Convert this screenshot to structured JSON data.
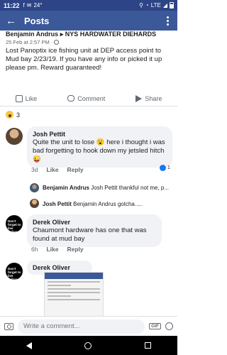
{
  "status_bar": {
    "time": "11:22",
    "temperature": "24°",
    "network": "LTE"
  },
  "app_bar": {
    "title": "Posts"
  },
  "post": {
    "author": "Benjamin Andrus",
    "group": "NYS HARDWATER DIEHARDS",
    "timestamp": "25 Feb at 2:57 PM ·",
    "body": "Lost Panoptix ice fishing unit at DEP access point to Mud bay 2/23/19. If you have any info or picked it up please pm. Reward guaranteed!",
    "actions": {
      "like": "Like",
      "comment": "Comment",
      "share": "Share"
    },
    "reaction_count": "3"
  },
  "comments": [
    {
      "name": "Josh Pettit",
      "text": "Quite the unit to lose 😮 here i thought i was bad forgetting to hook down my jetsled hitch 😜",
      "time": "3d",
      "like": "Like",
      "reply": "Reply",
      "likes": "1",
      "replies": [
        {
          "name": "Benjamin Andrus",
          "text": "Josh Pettit thankful not me, p..."
        },
        {
          "name": "Josh Pettit",
          "text": "Benjamin Andrus gotcha....."
        }
      ]
    },
    {
      "name": "Derek Oliver",
      "text": "Chaumont hardware has one that was found at mud bay",
      "time": "6h",
      "like": "Like",
      "reply": "Reply",
      "avatar_text": "Don't forget to live before you die."
    },
    {
      "name": "Derek Oliver",
      "avatar_text": "Don't forget to live before you die."
    }
  ],
  "composer": {
    "placeholder": "Write a comment...",
    "gif_label": "GIF"
  },
  "colors": {
    "brand": "#3b5998",
    "status_bar": "#2d4486",
    "like_blue": "#1877f2"
  }
}
